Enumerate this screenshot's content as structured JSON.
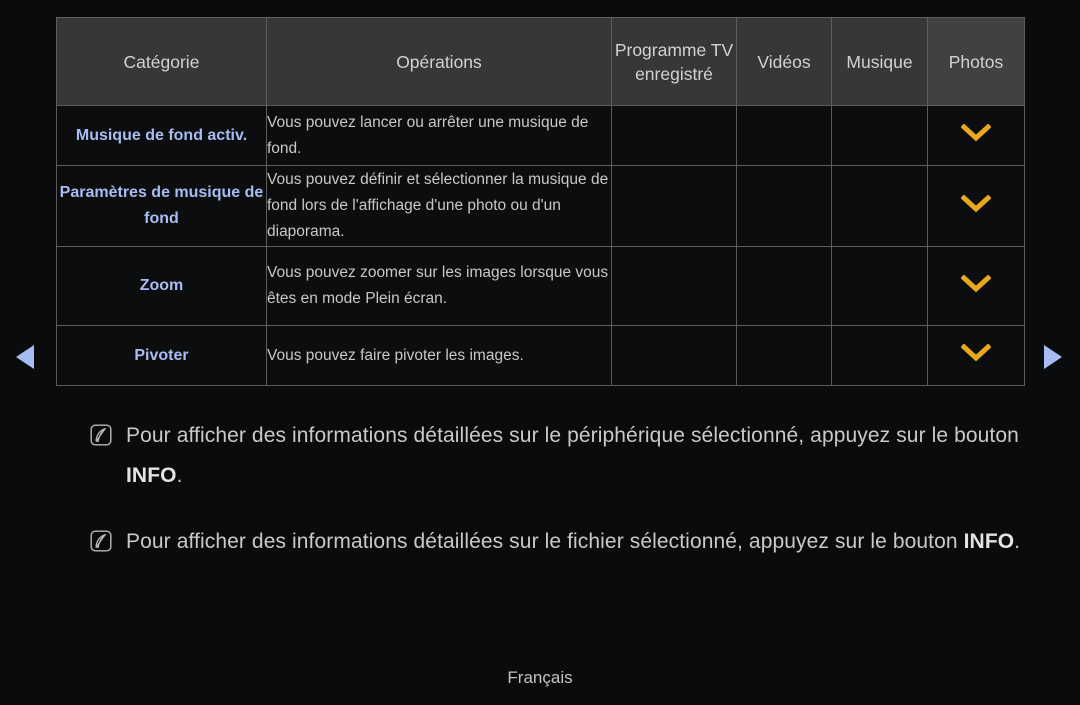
{
  "page": {
    "background_color": "#0a0b0d",
    "accent_blue": "#a7bdf2",
    "accent_gold": "#e8a81e",
    "text_color": "#c9c9c9"
  },
  "table": {
    "headers": [
      {
        "label": "Catégorie"
      },
      {
        "label": "Opérations"
      },
      {
        "label": "Programme TV enregistré"
      },
      {
        "label": "Vidéos"
      },
      {
        "label": "Musique"
      },
      {
        "label": "Photos"
      }
    ],
    "rows": [
      {
        "category": "Musique de fond activ.",
        "operation": "Vous pouvez lancer ou arrêter une musique de fond.",
        "programme_tv": "",
        "videos": "",
        "musique": "",
        "photos": "chevron-down-icon"
      },
      {
        "category": "Paramètres de musique de fond",
        "operation": "Vous pouvez définir et sélectionner la musique de fond lors de l'affichage d'une photo ou d'un diaporama.",
        "programme_tv": "",
        "videos": "",
        "musique": "",
        "photos": "chevron-down-icon"
      },
      {
        "category": "Zoom",
        "operation": "Vous pouvez zoomer sur les images lorsque vous êtes en mode Plein écran.",
        "programme_tv": "",
        "videos": "",
        "musique": "",
        "photos": "chevron-down-icon"
      },
      {
        "category": "Pivoter",
        "operation": "Vous pouvez faire pivoter les images.",
        "programme_tv": "",
        "videos": "",
        "musique": "",
        "photos": "chevron-down-icon"
      }
    ]
  },
  "navigation": {
    "previous_icon": "triangle-left-icon",
    "next_icon": "triangle-right-icon"
  },
  "notes": [
    {
      "icon": "note-pen-icon",
      "prefix": "Pour afficher des informations détaillées sur le périphérique sélectionné, appuyez sur le bouton ",
      "emphasis": "INFO",
      "suffix": "."
    },
    {
      "icon": "note-pen-icon",
      "prefix": "Pour afficher des informations détaillées sur le fichier sélectionné, appuyez sur le bouton ",
      "emphasis": "INFO",
      "suffix": "."
    }
  ],
  "footer": {
    "language": "Français"
  }
}
